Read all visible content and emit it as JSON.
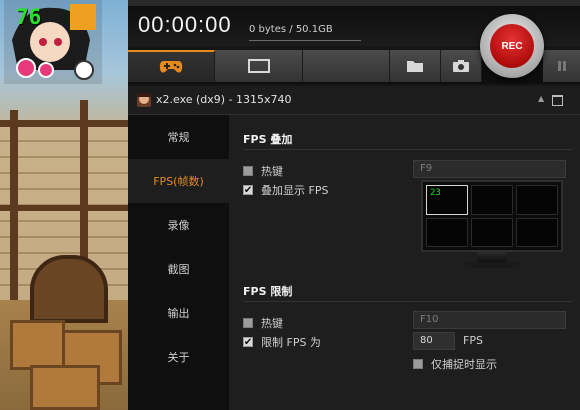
{
  "game": {
    "fps_overlay": "76"
  },
  "header": {
    "timer": "00:00:00",
    "size": "0 bytes / 50.1GB",
    "rec_label": "REC"
  },
  "tabs": [
    {
      "icon": "gamepad-icon",
      "active": true
    },
    {
      "icon": "screen-icon",
      "active": false
    },
    {
      "icon": "blank",
      "active": false
    },
    {
      "icon": "folder-icon",
      "active": false
    },
    {
      "icon": "camera-icon",
      "active": false
    }
  ],
  "source": {
    "text": "x2.exe (dx9) - 1315x740"
  },
  "nav": [
    {
      "label": "常规"
    },
    {
      "label": "FPS(帧数)",
      "active": true
    },
    {
      "label": "录像"
    },
    {
      "label": "截图"
    },
    {
      "label": "输出"
    },
    {
      "label": "关于"
    }
  ],
  "fps_overlay": {
    "title": "FPS 叠加",
    "hotkey_label": "热键",
    "hotkey_value": "F9",
    "show_label": "叠加显示 FPS",
    "preview_value": "23"
  },
  "fps_limit": {
    "title": "FPS 限制",
    "hotkey_label": "热键",
    "hotkey_value": "F10",
    "limit_label": "限制 FPS 为",
    "limit_value": "80",
    "limit_unit": "FPS",
    "capture_only_label": "仅捕捉时显示"
  },
  "colors": {
    "accent": "#e58a1f",
    "rec": "#c71212",
    "fps_green": "#28e02c"
  }
}
